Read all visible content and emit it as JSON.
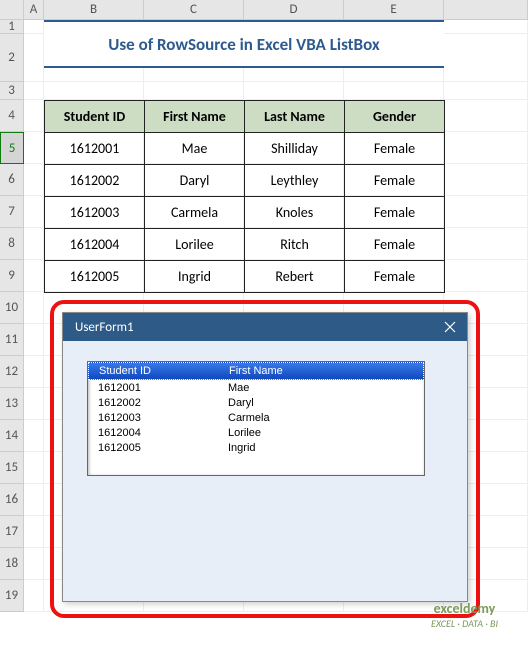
{
  "columns": [
    "",
    "A",
    "B",
    "C",
    "D",
    "E",
    ""
  ],
  "rows": [
    "1",
    "2",
    "3",
    "4",
    "5",
    "6",
    "7",
    "8",
    "9",
    "10",
    "11",
    "12",
    "13",
    "14",
    "15",
    "16",
    "17",
    "18",
    "19"
  ],
  "selected_row": "5",
  "title": "Use of RowSource in Excel VBA ListBox",
  "table": {
    "headers": [
      "Student ID",
      "First Name",
      "Last Name",
      "Gender"
    ],
    "rows": [
      [
        "1612001",
        "Mae",
        "Shilliday",
        "Female"
      ],
      [
        "1612002",
        "Daryl",
        "Leythley",
        "Female"
      ],
      [
        "1612003",
        "Carmela",
        "Knoles",
        "Female"
      ],
      [
        "1612004",
        "Lorilee",
        "Ritch",
        "Female"
      ],
      [
        "1612005",
        "Ingrid",
        "Rebert",
        "Female"
      ]
    ]
  },
  "userform": {
    "title": "UserForm1",
    "listbox_headers": [
      "Student ID",
      "First Name"
    ],
    "listbox_rows": [
      [
        "1612001",
        "Mae"
      ],
      [
        "1612002",
        "Daryl"
      ],
      [
        "1612003",
        "Carmela"
      ],
      [
        "1612004",
        "Lorilee"
      ],
      [
        "1612005",
        "Ingrid"
      ]
    ]
  },
  "watermark": {
    "line1": "exceldemy",
    "line2": "EXCEL · DATA · BI"
  }
}
